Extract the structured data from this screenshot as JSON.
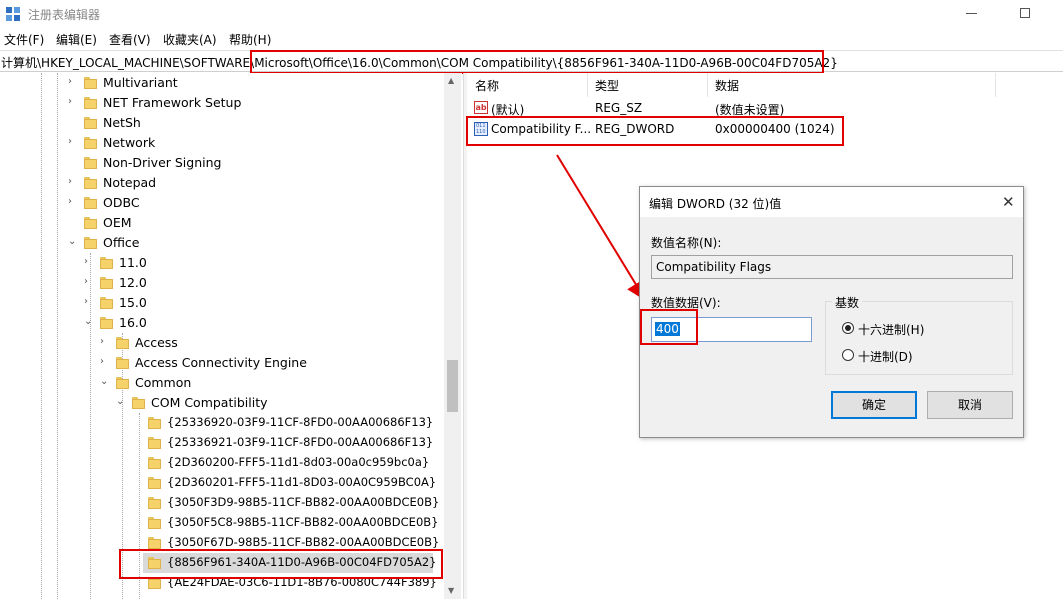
{
  "window": {
    "title": "注册表编辑器"
  },
  "menu": [
    "文件(F)",
    "编辑(E)",
    "查看(V)",
    "收藏夹(A)",
    "帮助(H)"
  ],
  "address": {
    "prefix": "计算机\\HKEY_LOCAL_MACHINE\\SOFTWARE\\",
    "highlighted": "Microsoft\\Office\\16.0\\Common\\COM Compatibility\\{8856F961-340A-11D0-A96B-00C04FD705A2}"
  },
  "tree": [
    {
      "label": "Multivariant"
    },
    {
      "label": "NET Framework Setup"
    },
    {
      "label": "NetSh"
    },
    {
      "label": "Network"
    },
    {
      "label": "Non-Driver Signing"
    },
    {
      "label": "Notepad"
    },
    {
      "label": "ODBC"
    },
    {
      "label": "OEM"
    },
    {
      "label": "Office"
    },
    {
      "label": "11.0"
    },
    {
      "label": "12.0"
    },
    {
      "label": "15.0"
    },
    {
      "label": "16.0"
    },
    {
      "label": "Access"
    },
    {
      "label": "Access Connectivity Engine"
    },
    {
      "label": "Common"
    },
    {
      "label": "COM Compatibility"
    },
    {
      "label": "{25336920-03F9-11CF-8FD0-00AA00686F13}"
    },
    {
      "label": "{25336921-03F9-11CF-8FD0-00AA00686F13}"
    },
    {
      "label": "{2D360200-FFF5-11d1-8d03-00a0c959bc0a}"
    },
    {
      "label": "{2D360201-FFF5-11d1-8D03-00A0C959BC0A}"
    },
    {
      "label": "{3050F3D9-98B5-11CF-BB82-00AA00BDCE0B}"
    },
    {
      "label": "{3050F5C8-98B5-11CF-BB82-00AA00BDCE0B}"
    },
    {
      "label": "{3050F67D-98B5-11CF-BB82-00AA00BDCE0B}"
    },
    {
      "label": "{8856F961-340A-11D0-A96B-00C04FD705A2}"
    },
    {
      "label": "{AE24FDAE-03C6-11D1-8B76-0080C744F389}"
    }
  ],
  "list": {
    "columns": [
      "名称",
      "类型",
      "数据"
    ],
    "rows": [
      {
        "name": "(默认)",
        "type": "REG_SZ",
        "data": "(数值未设置)",
        "icon": "string-value-icon"
      },
      {
        "name": "Compatibility F...",
        "type": "REG_DWORD",
        "data": "0x00000400 (1024)",
        "icon": "binary-value-icon"
      }
    ]
  },
  "dialog": {
    "title": "编辑 DWORD (32 位)值",
    "name_label": "数值名称(N):",
    "name_value": "Compatibility Flags",
    "data_label": "数值数据(V):",
    "data_value": "400",
    "base_label": "基数",
    "hex_label": "十六进制(H)",
    "dec_label": "十进制(D)",
    "selected_base": "hex",
    "ok_label": "确定",
    "cancel_label": "取消"
  },
  "colors": {
    "annotation": "#e00000",
    "selection": "#0078d7"
  }
}
